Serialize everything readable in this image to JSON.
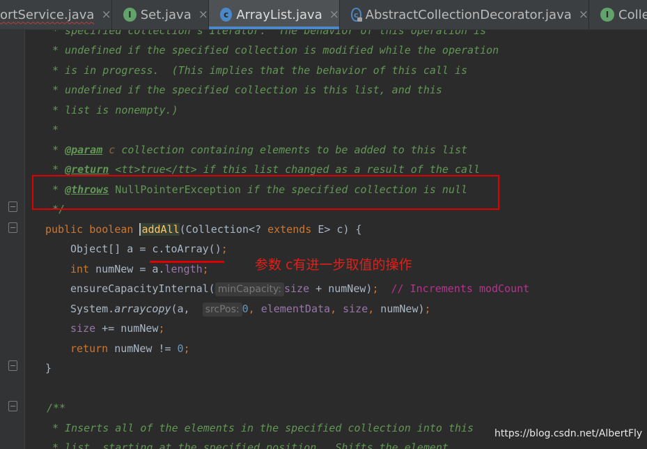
{
  "tabs": [
    {
      "label": "ortService.java",
      "icon": "none",
      "close": "×"
    },
    {
      "label": "Set.java",
      "icon": "interface",
      "icon_letter": "I",
      "close": "×"
    },
    {
      "label": "ArrayList.java",
      "icon": "class",
      "icon_letter": "c",
      "close": "×",
      "active": true
    },
    {
      "label": "AbstractCollectionDecorator.java",
      "icon": "abstract-class",
      "icon_letter": "c",
      "close": "×"
    },
    {
      "label": "Colle",
      "icon": "interface",
      "icon_letter": "I"
    }
  ],
  "code": {
    "l0": "* specified collection's Iterator.  The behavior of this operation is",
    "l1": "* undefined if the specified collection is modified while the operation",
    "l2": "* is in progress.  (This implies that the behavior of this call is",
    "l3": "* undefined if the specified collection is this list, and this",
    "l4": "* list is nonempty.)",
    "l5": "*",
    "l6_pre": "* ",
    "l6_tag": "@param",
    "l6_ref": " c",
    "l6_post": " collection containing elements to be added to this list",
    "l7_pre": "* ",
    "l7_tag": "@return",
    "l7_post": " <tt>true</tt> if this list changed as a result of the call",
    "l8_pre": "* ",
    "l8_tag": "@throws",
    "l8_val": " NullPointerException",
    "l8_post": " if the specified collection is null",
    "l9": "*/",
    "l10": {
      "kw1": "public",
      "kw2": "boolean",
      "name": "addAll",
      "rest1": "(Collection<?",
      "kw3": "extends",
      "rest2": "E> c) {"
    },
    "l11": {
      "pre": "Object[] a = c.toArray()",
      "semi": ";"
    },
    "l12": {
      "kw": "int",
      "pre": " numNew = a.",
      "fld": "length",
      "semi": ";"
    },
    "l13": {
      "pre": "ensureCapacityInternal(",
      "hint": "minCapacity:",
      "mid": "size + numNew)",
      "semi": ";",
      "cmt": "// Increments modCount"
    },
    "l14": {
      "pre": "System.",
      "method": "arraycopy",
      "mid": "(a,",
      "hint": "srcPos:",
      "num": "0",
      "c1": ",",
      "f1": "elementData",
      "c2": ",",
      "f2": "size",
      "c3": ",",
      "end": " numNew)",
      "semi": ";"
    },
    "l15": {
      "fld": "size",
      "pre": " += numNew",
      "semi": ";"
    },
    "l16": {
      "kw": "return",
      "pre": " numNew != ",
      "num": "0",
      "semi": ";"
    },
    "l17": "}",
    "l18": "/**",
    "l19": "* Inserts all of the elements in the specified collection into this",
    "l20": "* list, starting at the specified position.  Shifts the element"
  },
  "annotation": {
    "note": "参数 c有进一步取值的操作"
  },
  "watermark": "https://blog.csdn.net/AlbertFly"
}
